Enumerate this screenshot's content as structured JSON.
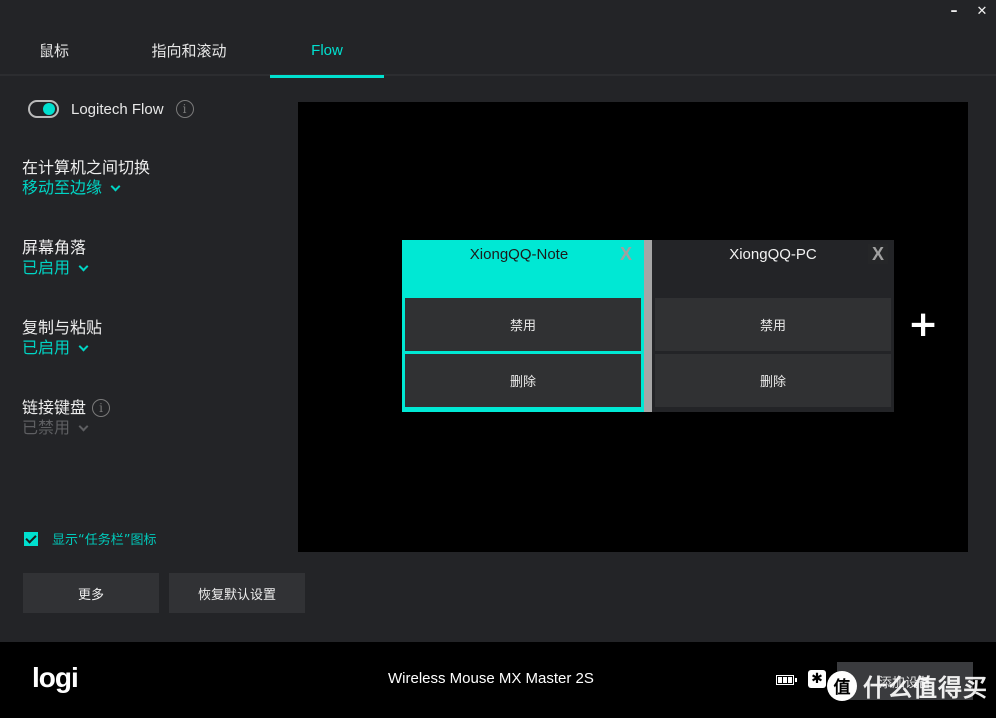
{
  "window": {
    "minimize_label": "–",
    "close_label": "✕"
  },
  "tabs": [
    {
      "label": "鼠标",
      "active": false
    },
    {
      "label": "指向和滚动",
      "active": false
    },
    {
      "label": "Flow",
      "active": true
    }
  ],
  "flow": {
    "toggle_label": "Logitech Flow",
    "toggle_on": true,
    "info_icon": "i"
  },
  "settings": [
    {
      "title": "在计算机之间切换",
      "value": "移动至边缘",
      "enabled": true,
      "info": false
    },
    {
      "title": "屏幕角落",
      "value": "已启用",
      "enabled": true,
      "info": false
    },
    {
      "title": "复制与粘贴",
      "value": "已启用",
      "enabled": true,
      "info": false
    },
    {
      "title": "链接键盘",
      "value": "已禁用",
      "enabled": false,
      "info": true
    }
  ],
  "taskbar": {
    "label": "显示“任务栏”图标",
    "checked": true
  },
  "buttons": {
    "more": "更多",
    "reset": "恢复默认设置"
  },
  "computers": [
    {
      "name": "XiongQQ-Note",
      "close": "X",
      "disable": "禁用",
      "delete": "删除",
      "active": true
    },
    {
      "name": "XiongQQ-PC",
      "close": "X",
      "disable": "禁用",
      "delete": "删除",
      "active": false
    }
  ],
  "add_computer_label": "+",
  "footer": {
    "logo": "logi",
    "device_name": "Wireless Mouse MX Master 2S",
    "add_device": "添加设备",
    "connect_glyph": "✱",
    "watermark_badge": "值",
    "watermark_text": "什么值得买"
  },
  "colors": {
    "accent": "#00e0cf",
    "background": "#232427",
    "canvas": "#000000"
  }
}
